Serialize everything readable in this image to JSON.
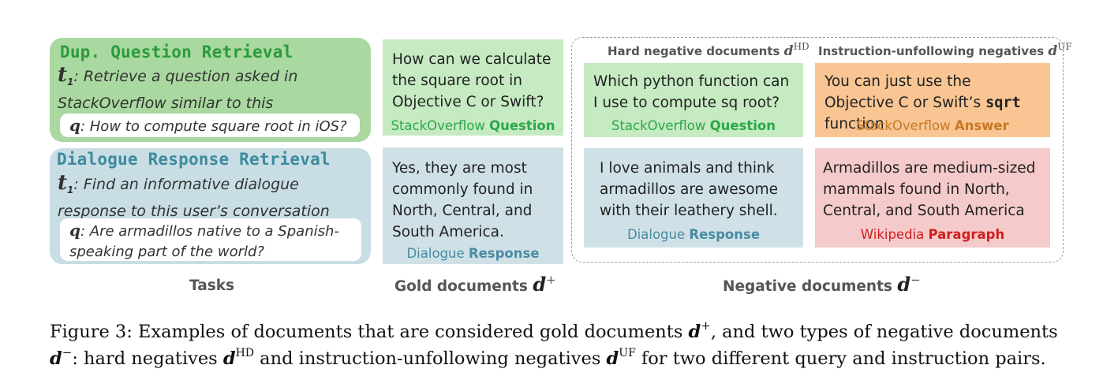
{
  "tasks": [
    {
      "name": "Dup. Question Retrieval",
      "instruction_symbol": "t",
      "instruction_subscript": "1",
      "instruction": ": Retrieve a question asked in StackOverflow similar to this",
      "query_symbol": "q",
      "query": ": How to compute square root in iOS?"
    },
    {
      "name": "Dialogue Response Retrieval",
      "instruction_symbol": "t",
      "instruction_subscript": "1",
      "instruction": ": Find an informative dialogue response to this user’s conversation",
      "query_symbol": "q",
      "query": ": Are armadillos native to a Spanish-speaking part of the world?"
    }
  ],
  "gold_documents": [
    {
      "text": "How can we calculate the square root in Objective C or Swift?",
      "source": "StackOverflow",
      "type": "Question"
    },
    {
      "text": "Yes, they are most commonly found in North, Central, and South America.",
      "source": "Dialogue",
      "type": "Response"
    }
  ],
  "negative_headers": {
    "hard": "Hard negative documents",
    "hard_sup": "HD",
    "unfollowing": "Instruction-unfollowing negatives",
    "unfollowing_sup": "UF",
    "symbol": "d"
  },
  "hard_negatives": [
    {
      "text": "Which python function can I use to compute sq root?",
      "source": "StackOverflow",
      "type": "Question"
    },
    {
      "text": "I love animals and think armadillos are awesome with their leathery shell.",
      "source": "Dialogue",
      "type": "Response"
    }
  ],
  "unfollowing_negatives": [
    {
      "text_before": "You can just use the Objective C or Swift’s ",
      "code": "sqrt",
      "text_after": " function",
      "source": "StackOverflow",
      "type": "Answer"
    },
    {
      "text": "Armadillos are medium-sized mammals found in North, Central, and South America",
      "source": "Wikipedia",
      "type": "Paragraph"
    }
  ],
  "column_labels": {
    "tasks": "Tasks",
    "gold": "Gold documents",
    "gold_sup": "+",
    "negative": "Negative documents",
    "negative_sup": "−",
    "symbol": "d"
  },
  "caption": {
    "line1_a": "Figure 3: Examples of documents that are considered gold documents ",
    "line1_sup": "+",
    "line1_b": ", and two types of negative documents",
    "line2_sup1": "−",
    "line2_a": ": hard negatives ",
    "line2_sup2": "HD",
    "line2_b": " and instruction-unfollowing negatives ",
    "line2_sup3": "UF",
    "line2_c": " for two different query and instruction pairs.",
    "symbol": "d"
  }
}
